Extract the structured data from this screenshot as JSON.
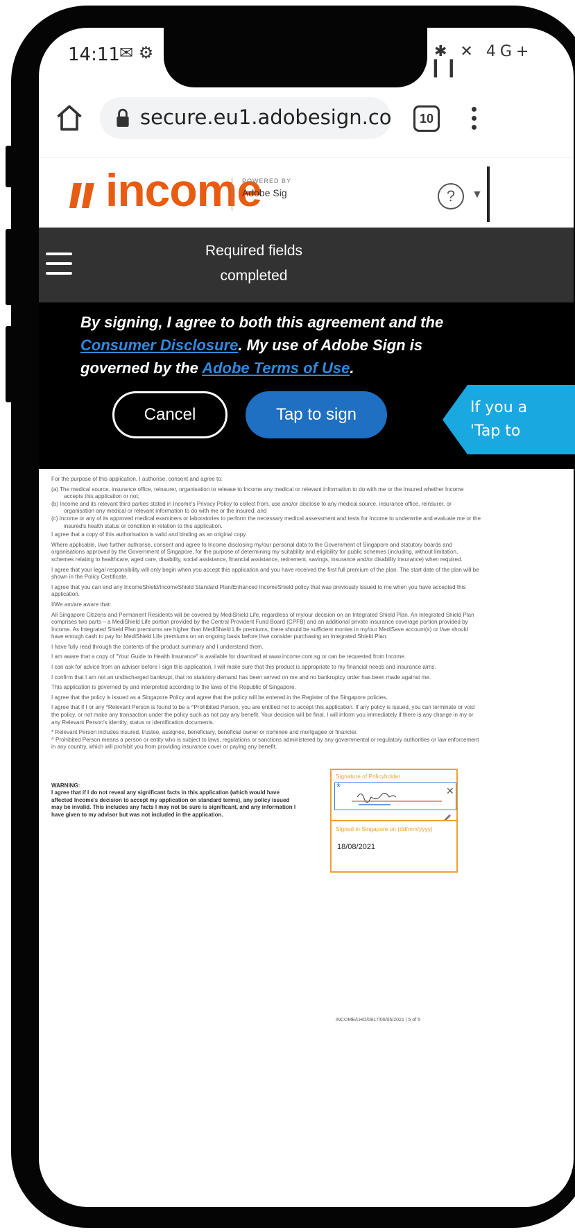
{
  "status_bar": {
    "time": "14:11",
    "left_icons": "✉ ⚙",
    "right_icons": "✱ ✕ 4G+ ▎▎"
  },
  "browser": {
    "url": "secure.eu1.adobesign.com/pub",
    "tab_count": "10"
  },
  "brand": {
    "name": "income",
    "powered_by": "POWERED BY",
    "powered_name": "Adobe Sig",
    "color": "#e85c12"
  },
  "toolbar": {
    "title_line1": "Required fields",
    "title_line2": "completed"
  },
  "consent": {
    "part1": "By signing, I agree to both this agreement and the ",
    "link1": "Consumer Disclosure",
    "part2": ". My use of Adobe Sign is governed by the ",
    "link2": "Adobe Terms of Use",
    "part3": ".",
    "cancel_label": "Cancel",
    "sign_label": "Tap to sign"
  },
  "callout": {
    "line1": "If you a",
    "line2": "'Tap to"
  },
  "document": {
    "p1": "For the purpose of this application, I authorise, consent and agree to:",
    "list1": [
      "(a) The medical source, insurance office, reinsurer, organisation to release to Income any medical or relevant information to do with me or the Insured whether Income accepts this application or not;",
      "(b) Income and its relevant third parties stated in Income's Privacy Policy to collect from, use and/or disclose to any medical source, insurance office, reinsurer, or organisation any medical or relevant information to do with me or the insured; and",
      "(c) Income or any of its approved medical examiners or laboratories to perform the necessary medical assessment and tests for Income to underwrite and evaluate me or the insured's health status or condition in relation to this application."
    ],
    "p2": "I agree that a copy of this authorisation is valid and binding as an original copy.",
    "p3": "Where applicable, I/we further authorise, consent and agree to Income disclosing my/our personal data to the Government of Singapore and statutory boards and organisations approved by the Government of Singapore, for the purpose of determining my suitability and eligibility for public schemes (including, without limitation, schemes relating to healthcare, aged care, disability, social assistance, financial assistance, retirement, savings, insurance and/or disability insurance) when required.",
    "p4": "I agree that your legal responsibility will only begin when you accept this application and you have received the first full premium of the plan. The start date of the plan will be shown in the Policy Certificate.",
    "p5": "I agree that you can end any IncomeShield/IncomeShield Standard Plan/Enhanced IncomeShield policy that was previously issued to me when you have accepted this application.",
    "p6": "I/We am/are aware that:",
    "p7": "All Singapore Citizens and Permanent Residents will be covered by MediShield Life, regardless of my/our decision on an Integrated Shield Plan. An Integrated Shield Plan comprises two parts – a MediShield Life portion provided by the Central Provident Fund Board (CPFB) and an additional private insurance coverage portion provided by Income. As Integrated Shield Plan premiums are higher than MediShield Life premiums, there should be sufficient monies in my/our MediSave account(s) or I/we should have enough cash to pay for MediShield Life premiums on an ongoing basis before I/we consider purchasing an Integrated Shield Plan.",
    "p8": "I have fully read through the contents of the product summary and I understand them.",
    "p9": "I am aware that a copy of \"Your Guide to Health Insurance\" is available for download at www.income.com.sg or can be requested from Income.",
    "p10": "I can ask for advice from an adviser before I sign this application. I will make sure that this product is appropriate to my financial needs and insurance aims.",
    "p11": "I confirm that I am not an undischarged bankrupt, that no statutory demand has been served on me and no bankruptcy order has been made against me.",
    "p12": "This application is governed by and interpreted according to the laws of the Republic of Singapore.",
    "p13": "I agree that the policy is issued as a Singapore Policy and agree that the policy will be entered in the Register of the Singapore policies.",
    "p14": "I agree that if I or any *Relevant Person is found to be a ^Prohibited Person, you are entitled not to accept this application. If any policy is issued, you can terminate or void the policy, or not make any transaction under the policy such as not pay any benefit. Your decision will be final. I will inform you immediately if there is any change in my or any Relevant Person's identity, status or identification documents.",
    "p15": "* Relevant Person includes insured, trustee, assignee, beneficiary, beneficial owner or nominee and mortgagee or financier.",
    "p16": "^ Prohibited Person means a person or entity who is subject to laws, regulations or sanctions administered by any governmental or regulatory authorities or law enforcement in any country, which will prohibit you from providing insurance cover or paying any benefit.",
    "warning_title": "WARNING:",
    "warning_text": "I agree that if I do not reveal any significant facts in this application (which would have affected Income's decision to accept my application on standard terms), any policy issued may be invalid. This includes any facts I may not be sure is significant, and any information I have given to my advisor but was not included in the application.",
    "sig_label": "Signature of Policyholder",
    "signed_label": "Signed in Singapore on (dd/mm/yyyy)",
    "signed_date": "18/08/2021",
    "footer": "INCOME/LHO/0817/06/05/2021  |  5 of 5"
  }
}
